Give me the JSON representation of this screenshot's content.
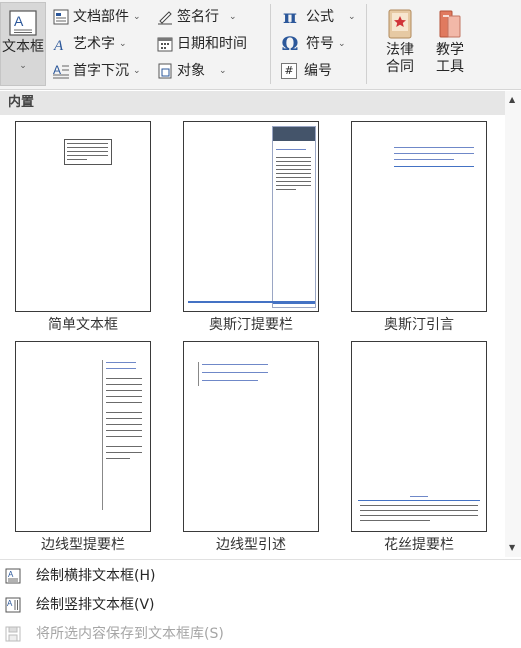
{
  "ribbon": {
    "textbox": {
      "label": "文本框",
      "icon": "text-box-icon"
    },
    "col1": [
      {
        "label": "文档部件",
        "icon": "quick-parts-icon",
        "dropdown": true
      },
      {
        "label": "艺术字",
        "icon": "wordart-icon",
        "dropdown": true
      },
      {
        "label": "首字下沉",
        "icon": "drop-cap-icon",
        "dropdown": true
      }
    ],
    "col2": [
      {
        "label": "签名行",
        "icon": "signature-line-icon",
        "dropdown": true
      },
      {
        "label": "日期和时间",
        "icon": "date-time-icon",
        "dropdown": false
      },
      {
        "label": "对象",
        "icon": "object-icon",
        "dropdown": true
      }
    ],
    "col3": [
      {
        "label": "公式",
        "icon": "pi-equation-icon",
        "glyph": "π",
        "dropdown": true
      },
      {
        "label": "符号",
        "icon": "omega-symbol-icon",
        "glyph": "Ω",
        "dropdown": true
      },
      {
        "label": "编号",
        "icon": "number-icon",
        "glyph": "#",
        "dropdown": false
      }
    ],
    "law_contract": {
      "label": "法律\n合同",
      "icon": "law-contract-icon"
    },
    "teaching_tools": {
      "label": "教学\n工具",
      "icon": "teaching-tools-icon"
    }
  },
  "gallery": {
    "section_title": "内置",
    "items": [
      {
        "label": "简单文本框"
      },
      {
        "label": "奥斯汀提要栏"
      },
      {
        "label": "奥斯汀引言"
      },
      {
        "label": "边线型提要栏"
      },
      {
        "label": "边线型引述"
      },
      {
        "label": "花丝提要栏"
      }
    ]
  },
  "footer": {
    "items": [
      {
        "label": "绘制横排文本框(H)",
        "icon": "draw-horizontal-textbox-icon",
        "enabled": true
      },
      {
        "label": "绘制竖排文本框(V)",
        "icon": "draw-vertical-textbox-icon",
        "enabled": true
      },
      {
        "label": "将所选内容保存到文本框库(S)",
        "icon": "save-to-gallery-icon",
        "enabled": false
      }
    ]
  },
  "colors": {
    "ribbon_bg": "#f3f3f3",
    "accent_blue": "#2b579a",
    "header_bg": "#e6e6e6",
    "disabled_text": "#a6a6a6"
  }
}
